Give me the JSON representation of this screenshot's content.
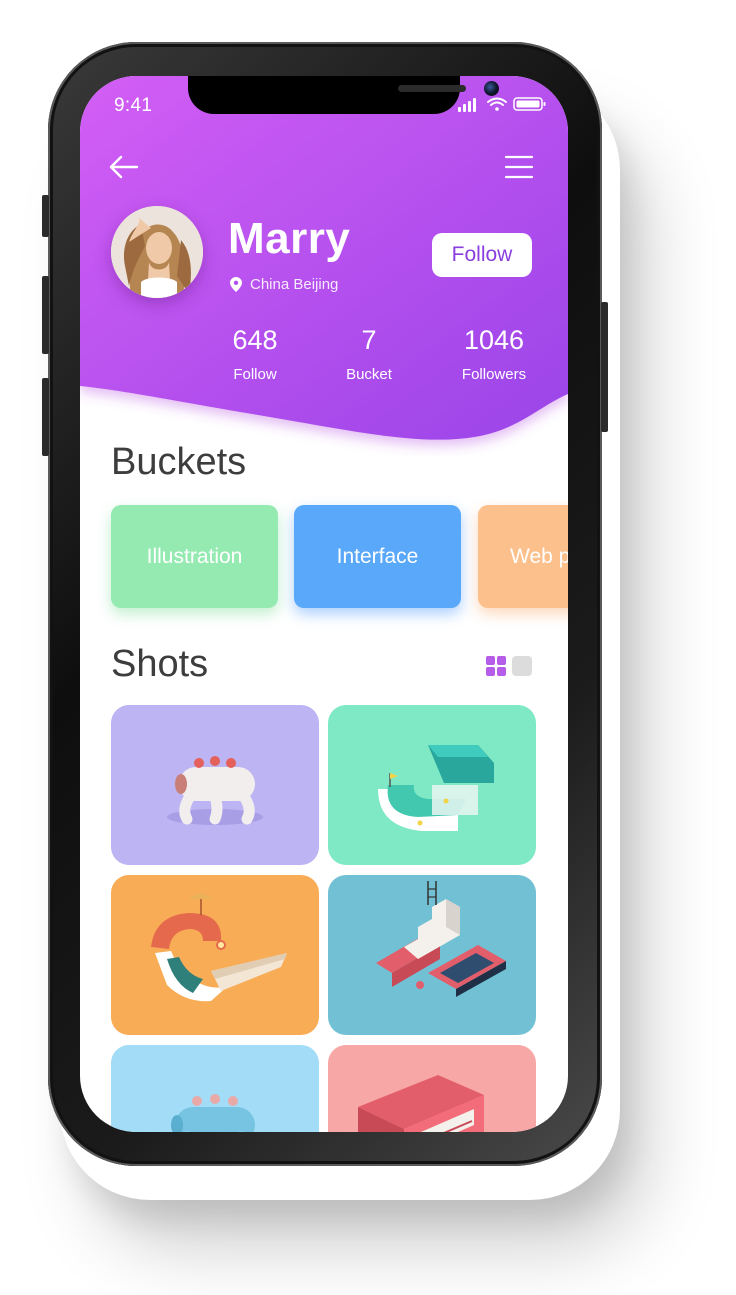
{
  "status_bar": {
    "time": "9:41"
  },
  "header": {
    "back_icon": "arrow-left-icon",
    "menu_icon": "hamburger-menu-icon",
    "gradient": [
      "#d35ef5",
      "#9a44e8"
    ]
  },
  "profile": {
    "name": "Marry",
    "location": "China Beijing",
    "location_icon": "location-pin-icon",
    "follow_button": "Follow"
  },
  "stats": [
    {
      "value": "648",
      "label": "Follow"
    },
    {
      "value": "7",
      "label": "Bucket"
    },
    {
      "value": "1046",
      "label": "Followers"
    }
  ],
  "buckets": {
    "title": "Buckets",
    "items": [
      {
        "label": "Illustration",
        "color": "#95eab1"
      },
      {
        "label": "Interface",
        "color": "#59a8fa"
      },
      {
        "label": "Web p",
        "color": "#fcc08c"
      }
    ]
  },
  "shots": {
    "title": "Shots",
    "view_icons": [
      "grid-view-icon",
      "list-view-icon"
    ],
    "accent": "#b55ce8",
    "items": [
      {
        "color": "#bdb4f3"
      },
      {
        "color": "#7ee9c4"
      },
      {
        "color": "#f9ac56"
      },
      {
        "color": "#72c0d3"
      },
      {
        "color": "#a3dcf7"
      },
      {
        "color": "#f7a7a5"
      }
    ]
  }
}
